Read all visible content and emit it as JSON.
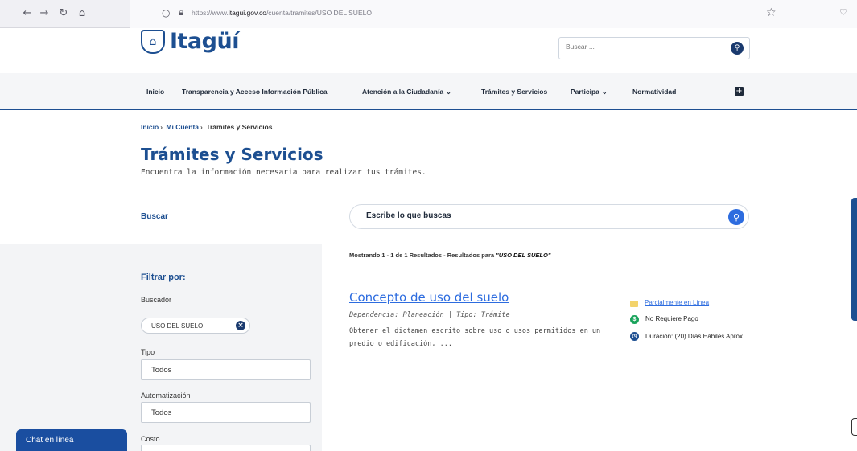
{
  "browser": {
    "back_icon": "arrow-left-icon",
    "forward_icon": "arrow-right-icon",
    "reload_icon": "reload-icon",
    "home_icon": "home-icon",
    "url_prefix": "https://www.",
    "url_domain": "itagui.gov.co",
    "url_path": "/cuenta/tramites/USO DEL SUELO"
  },
  "header": {
    "logo_text": "Itagüí",
    "search_placeholder": "Buscar ..."
  },
  "menu": {
    "items": [
      {
        "label": "Inicio"
      },
      {
        "label": "Transparencia y Acceso Información Pública"
      },
      {
        "label": "Atención a la Ciudadanía",
        "dropdown": true
      },
      {
        "label": "Trámites y Servicios"
      },
      {
        "label": "Participa",
        "dropdown": true
      },
      {
        "label": "Normatividad"
      }
    ]
  },
  "breadcrumb": {
    "items": [
      "Inicio",
      "Mi Cuenta",
      "Trámites y Servicios"
    ]
  },
  "page": {
    "title": "Trámites y Servicios",
    "subtitle": "Encuentra la información necesaria para realizar tus trámites."
  },
  "search": {
    "label": "Buscar",
    "placeholder": "Escribe lo que buscas"
  },
  "filters": {
    "title": "Filtrar por:",
    "buscador_label": "Buscador",
    "chip_value": "USO DEL SUELO",
    "tipo_label": "Tipo",
    "tipo_value": "Todos",
    "automatizacion_label": "Automatización",
    "automatizacion_value": "Todos",
    "costo_label": "Costo"
  },
  "results": {
    "summary_prefix": "Mostrando 1 - 1 de 1 Resultados - Resultados para",
    "summary_query": "\"USO DEL SUELO\"",
    "items": [
      {
        "title": "Concepto de uso del suelo",
        "dependency": "Dependencia: Planeación | Tipo: Trámite",
        "description": "Obtener el dictamen escrito sobre uso o usos permitidos en un predio o edificación, ...",
        "online": "Parcialmente en Línea",
        "payment": "No Requiere Pago",
        "duration": "Duración: (20) Días Hábiles Aprox."
      }
    ]
  },
  "chat": {
    "label": "Chat en línea"
  }
}
